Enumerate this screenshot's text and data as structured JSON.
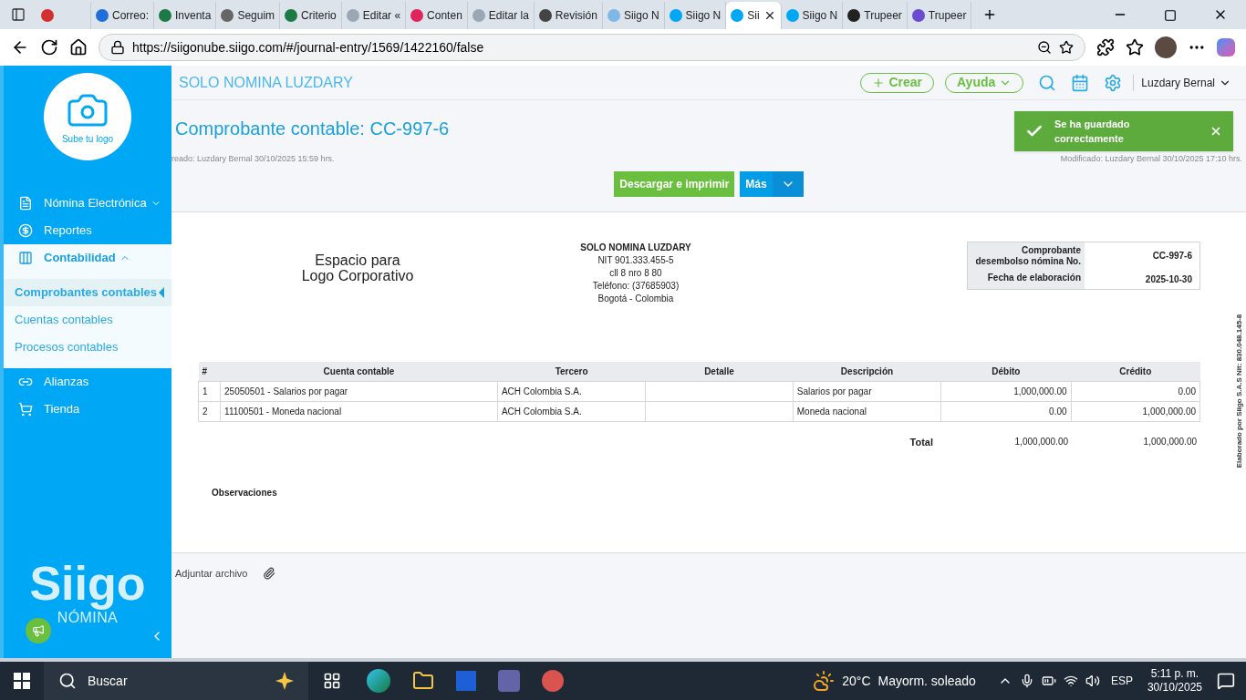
{
  "browser": {
    "tabs": [
      {
        "color": "#d32f2f",
        "selected": false
      },
      {
        "title": "Correo:",
        "color": "#1e6fd9",
        "selected": false
      },
      {
        "title": "Inventa",
        "color": "#1d7a45",
        "selected": false
      },
      {
        "title": "Seguim",
        "color": "#666666",
        "selected": false
      },
      {
        "title": "Criterio",
        "color": "#1d7a45",
        "selected": false
      },
      {
        "title": "Editar «",
        "color": "#9aa7b5",
        "selected": false
      },
      {
        "title": "Conten",
        "color": "#e0245e",
        "selected": false
      },
      {
        "title": "Editar la",
        "color": "#9aa7b5",
        "selected": false
      },
      {
        "title": "Revisión",
        "color": "#444444",
        "selected": false
      },
      {
        "title": "Siigo N",
        "color": "#7fb7e6",
        "selected": false
      },
      {
        "title": "Siigo N",
        "color": "#00a7f5",
        "selected": false
      },
      {
        "title": "Sii",
        "color": "#00a7f5",
        "selected": true
      },
      {
        "title": "Siigo N",
        "color": "#00a7f5",
        "selected": false
      },
      {
        "title": "Trupeer",
        "color": "#222222",
        "selected": false
      },
      {
        "title": "Trupeer",
        "color": "#6a4bd1",
        "selected": false
      }
    ],
    "url": "https://siigonube.siigo.com/#/journal-entry/1569/1422160/false"
  },
  "header": {
    "company": "SOLO NOMINA LUZDARY",
    "create": "Crear",
    "help": "Ayuda",
    "user": "Luzdary Bernal"
  },
  "sidebar": {
    "logo_upload": "Sube tu logo",
    "items": [
      {
        "label": "Nómina Electrónica",
        "expanded": false
      },
      {
        "label": "Reportes"
      },
      {
        "label": "Contabilidad",
        "expanded": true,
        "children": [
          {
            "label": "Comprobantes contables",
            "selected": true
          },
          {
            "label": "Cuentas contables",
            "selected": false
          },
          {
            "label": "Procesos contables",
            "selected": false
          }
        ]
      },
      {
        "label": "Alianzas"
      },
      {
        "label": "Tienda"
      }
    ],
    "brand": "Siigo",
    "brand_sub": "NÓMINA"
  },
  "voucher": {
    "title": "Comprobante contable: CC-997-6",
    "created": "reado: Luzdary Bernal 30/10/2025 15:59 hrs.",
    "modified": "Modificado: Luzdary Bernal 30/10/2025 17:10 hrs.",
    "download": "Descargar e imprimir",
    "more": "Más"
  },
  "toast": {
    "message": "Se ha guardado correctamente"
  },
  "document": {
    "logo_placeholder": "Espacio para\nLogo Corporativo",
    "issuer": [
      "SOLO NOMINA LUZDARY",
      "NIT 901.333.455-5",
      "cll 8 nro 8 80",
      "Teléfono: (37685903)",
      "Bogotá - Colombia"
    ],
    "info": [
      {
        "label": "Comprobante desembolso nómina No.",
        "value": "CC-997-6"
      },
      {
        "label": "Fecha de elaboración",
        "value": "2025-10-30"
      }
    ],
    "columns": [
      "#",
      "Cuenta contable",
      "Tercero",
      "Detalle",
      "Descripción",
      "Débito",
      "Crédito"
    ],
    "rows": [
      [
        "1",
        "25050501 - Salarios por pagar",
        "ACH Colombia S.A.",
        "",
        "Salarios por pagar",
        "1,000,000.00",
        "0.00"
      ],
      [
        "2",
        "11100501 - Moneda nacional",
        "ACH Colombia S.A.",
        "",
        "Moneda nacional",
        "0.00",
        "1,000,000.00"
      ]
    ],
    "total": {
      "label": "Total",
      "debit": "1,000,000.00",
      "credit": "1,000,000.00"
    },
    "observations": "Observaciones",
    "side_note": "Elaborado por Siigo S.A.S Nit: 830.048.145-8"
  },
  "attach": "Adjuntar archivo",
  "taskbar": {
    "search": "Buscar",
    "temperature": "20°C",
    "weather": "Mayorm. soleado",
    "language": "ESP",
    "time": "5:11 p. m.",
    "date": "30/10/2025"
  }
}
